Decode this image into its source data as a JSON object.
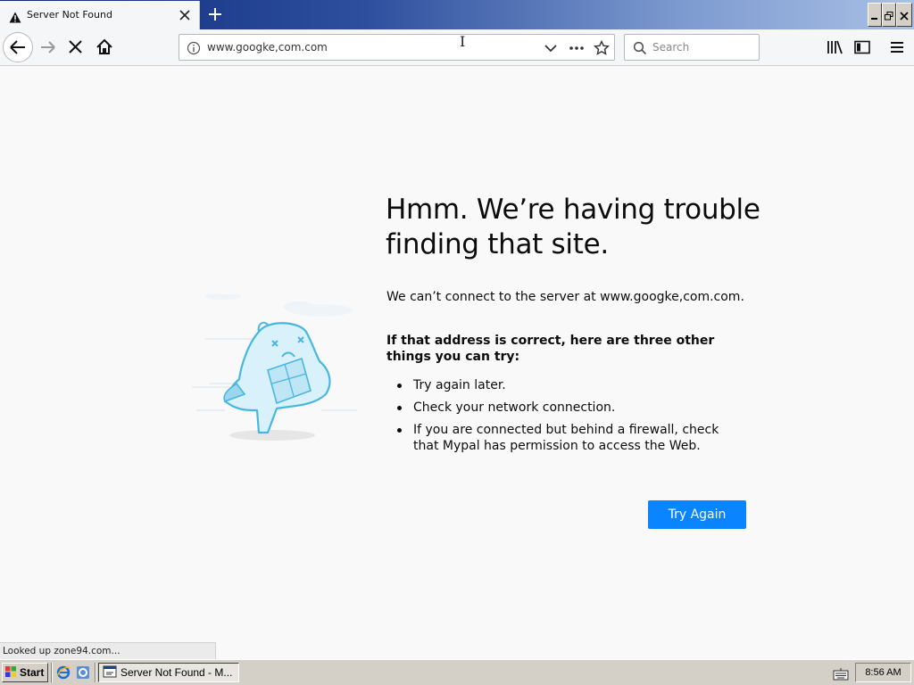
{
  "browser": {
    "tab": {
      "title": "Server Not Found",
      "icon": "warning-icon"
    },
    "url": "www.googke,com.com",
    "search_placeholder": "Search"
  },
  "error_page": {
    "heading": "Hmm. We’re having trouble finding that site.",
    "description": "We can’t connect to the server at www.googke,com.com.",
    "tips_title": "If that address is correct, here are three other things you can try:",
    "tips": [
      "Try again later.",
      "Check your network connection.",
      "If you are connected but behind a firewall, check that Mypal has permission to access the Web."
    ],
    "try_again_label": "Try Again",
    "accent_color": "#0a84ff"
  },
  "status_text": "Looked up zone94.com...",
  "taskbar": {
    "start_label": "Start",
    "task_label": "Server Not Found - M...",
    "clock": "8:56 AM"
  }
}
